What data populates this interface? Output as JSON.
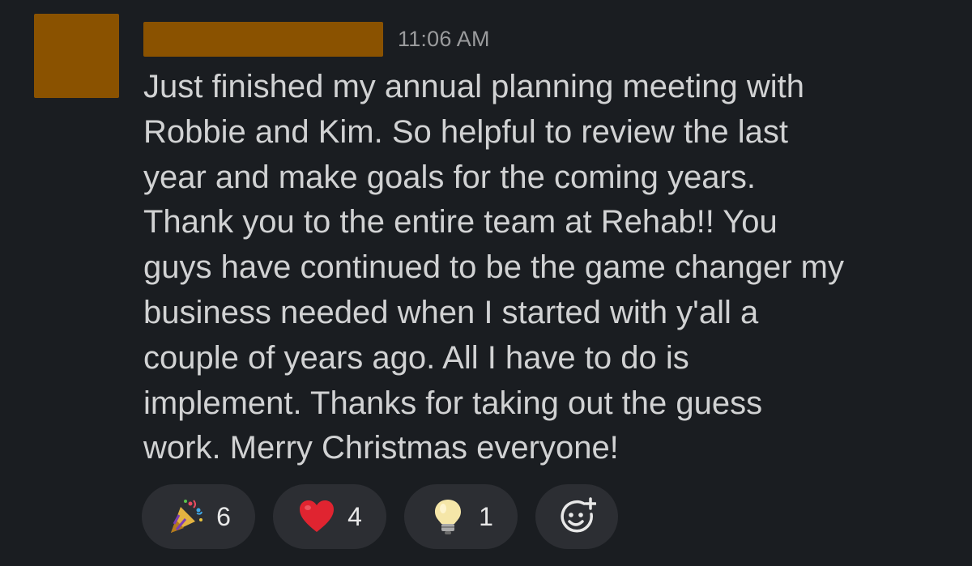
{
  "message": {
    "timestamp": "11:06 AM",
    "text": "Just finished my annual planning meeting with\nRobbie and Kim. So helpful to review the last\nyear and make goals for the coming years.\nThank you to the entire team at Rehab!! You\nguys have continued to be the game changer my\nbusiness needed when I started with y'all a\ncouple of years ago. All I have to do is\nimplement. Thanks for taking out the guess\nwork. Merry Christmas everyone!"
  },
  "reactions": [
    {
      "icon": "party-popper-icon",
      "count": "6"
    },
    {
      "icon": "red-heart-icon",
      "count": "4"
    },
    {
      "icon": "light-bulb-icon",
      "count": "1"
    }
  ],
  "add_reaction": {
    "icon": "add-reaction-icon"
  },
  "colors": {
    "background": "#1a1d21",
    "redaction": "#8a5200",
    "text": "#d1d2d3",
    "timestamp": "#9a9b9d",
    "pill": "#2c2e33"
  }
}
